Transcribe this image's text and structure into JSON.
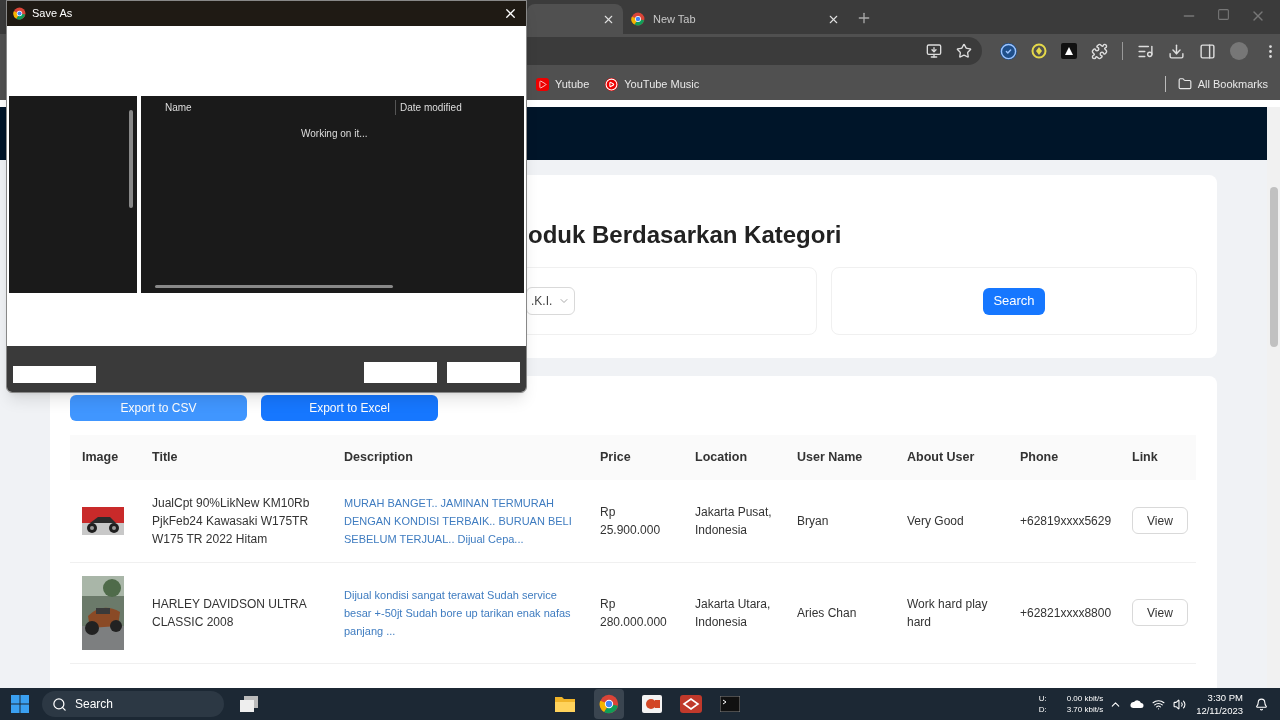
{
  "browser": {
    "tabs": [
      {
        "selected": true
      },
      {
        "title": "New Tab",
        "selected": false
      }
    ],
    "bookmarks": [
      {
        "label": "Yutube",
        "kind": "youtube"
      },
      {
        "label": "YouTube Music",
        "kind": "music"
      }
    ],
    "all_bookmarks": "All Bookmarks"
  },
  "dialog": {
    "title": "Save As",
    "columns": [
      "Name",
      "Date modified"
    ],
    "status": "Working on it..."
  },
  "page": {
    "heading": "oduk Berdasarkan Kategori",
    "category_select": ".K.I.",
    "search_button": "Search",
    "export_buttons": [
      {
        "label": "Export to CSV",
        "hovered": true
      },
      {
        "label": "Export to Excel",
        "hovered": false
      }
    ],
    "table": {
      "columns": [
        "Image",
        "Title",
        "Description",
        "Price",
        "Location",
        "User Name",
        "About User",
        "Phone",
        "Link"
      ],
      "rows": [
        {
          "kind": "wide",
          "title": "JualCpt 90%LikNew KM10Rb PjkFeb24 Kawasaki W175TR W175 TR 2022 Hitam",
          "description": "MURAH BANGET.. JAMINAN TERMURAH DENGAN KONDISI TERBAIK.. BURUAN BELI SEBELUM TERJUAL.. Dijual Cepa...",
          "price": "Rp 25.900.000",
          "location": "Jakarta Pusat, Indonesia",
          "user": "Bryan",
          "about": "Very Good",
          "phone": "+62819xxxx5629",
          "link": "View"
        },
        {
          "kind": "tall",
          "title": "HARLEY DAVIDSON ULTRA CLASSIC 2008",
          "description": "Dijual kondisi sangat terawat Sudah service besar +-50jt Sudah bore up tarikan enak nafas panjang ...",
          "price": "Rp 280.000.000",
          "location": "Jakarta Utara, Indonesia",
          "user": "Aries Chan",
          "about": "Work hard play hard",
          "phone": "+62821xxxx8800",
          "link": "View"
        }
      ]
    }
  },
  "taskbar": {
    "search": "Search",
    "upload_label": "U:",
    "upload_rate": "0.00 kbit/s",
    "download_label": "D:",
    "download_rate": "3.70 kbit/s",
    "time": "3:30 PM",
    "date": "12/11/2023"
  }
}
